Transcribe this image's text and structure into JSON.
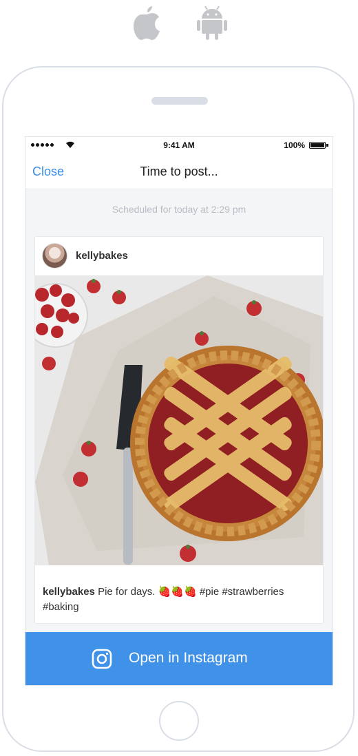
{
  "platforms": [
    {
      "icon": "apple-icon"
    },
    {
      "icon": "android-icon"
    }
  ],
  "status_bar": {
    "time": "9:41 AM",
    "battery": "100%"
  },
  "nav": {
    "close_label": "Close",
    "title": "Time to post..."
  },
  "scheduled_text": "Scheduled for today at 2:29 pm",
  "post": {
    "username": "kellybakes",
    "caption_user": "kellybakes",
    "caption_text": "Pie for days. 🍓🍓🍓 #pie #strawberries #baking"
  },
  "open_button": {
    "label": "Open in Instagram",
    "icon": "instagram-icon"
  },
  "colors": {
    "accent": "#3f92e8",
    "link": "#3a8ee6",
    "frame": "#d8dde6"
  }
}
